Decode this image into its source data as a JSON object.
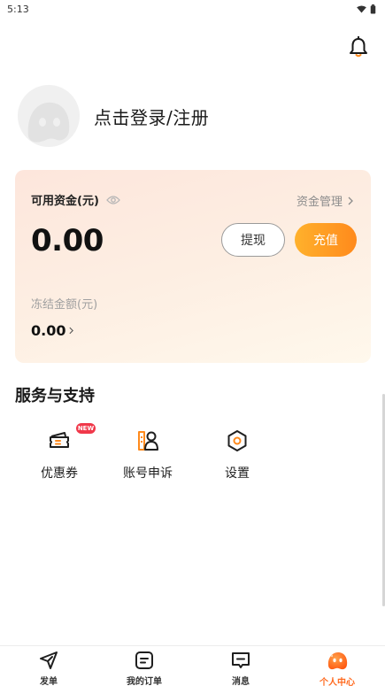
{
  "status_bar": {
    "time": "5:13"
  },
  "profile": {
    "login_text": "点击登录/注册"
  },
  "wallet": {
    "available_title": "可用资金(元)",
    "fund_manage": "资金管理",
    "balance": "0.00",
    "withdraw_label": "提现",
    "recharge_label": "充值",
    "frozen_label": "冻结金额(元)",
    "frozen_value": "0.00"
  },
  "services": {
    "title": "服务与支持",
    "items": [
      {
        "label": "优惠券",
        "icon": "coupon-icon",
        "badge": "NEW"
      },
      {
        "label": "账号申诉",
        "icon": "appeal-icon"
      },
      {
        "label": "设置",
        "icon": "settings-icon"
      }
    ]
  },
  "tabbar": {
    "items": [
      {
        "label": "发单",
        "icon": "send-icon"
      },
      {
        "label": "我的订单",
        "icon": "orders-icon"
      },
      {
        "label": "消息",
        "icon": "message-icon"
      },
      {
        "label": "个人中心",
        "icon": "profile-mascot-icon",
        "active": true
      }
    ]
  },
  "colors": {
    "accent": "#ff8a1c",
    "badge": "#f0384a",
    "active_tab": "#ff6a1f"
  }
}
